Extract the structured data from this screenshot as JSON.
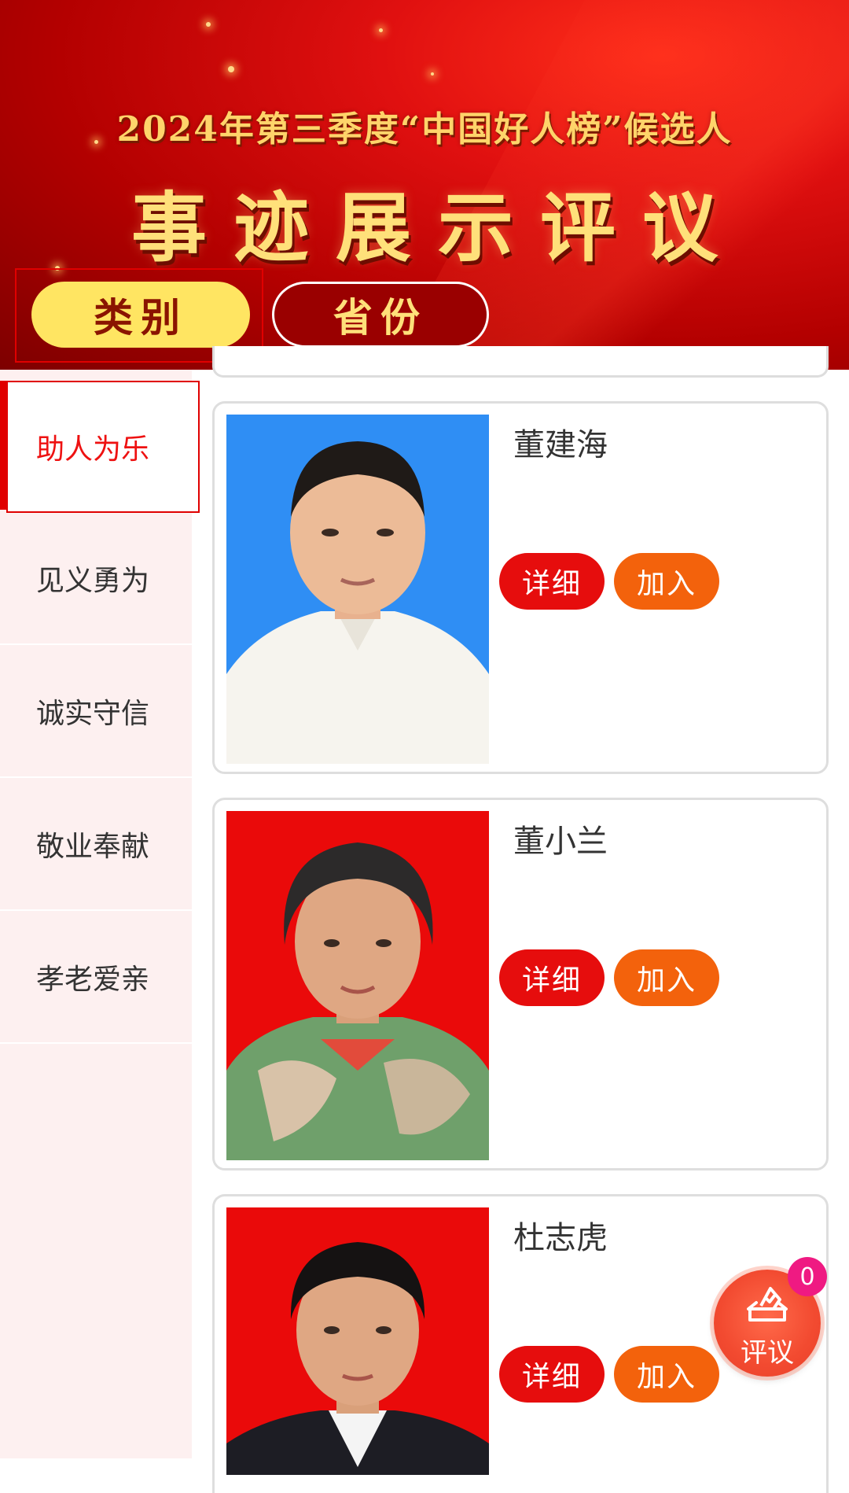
{
  "banner": {
    "subtitle": "2024年第三季度“中国好人榜”候选人",
    "title": "事迹展示评议",
    "tabs": [
      {
        "label": "类别",
        "selected": true
      },
      {
        "label": "省份",
        "selected": false
      }
    ]
  },
  "sidebar": {
    "items": [
      {
        "label": "助人为乐",
        "active": true
      },
      {
        "label": "见义勇为",
        "active": false
      },
      {
        "label": "诚实守信",
        "active": false
      },
      {
        "label": "敬业奉献",
        "active": false
      },
      {
        "label": "孝老爱亲",
        "active": false
      }
    ]
  },
  "candidates": [
    {
      "name": "董建海",
      "detail_label": "详细",
      "join_label": "加入",
      "photo_background": "#2f8ef4"
    },
    {
      "name": "董小兰",
      "detail_label": "详细",
      "join_label": "加入",
      "photo_background": "#ea0a0a"
    },
    {
      "name": "杜志虎",
      "detail_label": "详细",
      "join_label": "加入",
      "photo_background": "#ea0a0a"
    }
  ],
  "floating_button": {
    "label": "评议",
    "badge_count": "0",
    "icon": "ballot-box-icon"
  },
  "colors": {
    "accent_red": "#e00000",
    "join_orange": "#f3620c",
    "badge_pink": "#ef1a82",
    "tab_yellow": "#ffe562"
  }
}
